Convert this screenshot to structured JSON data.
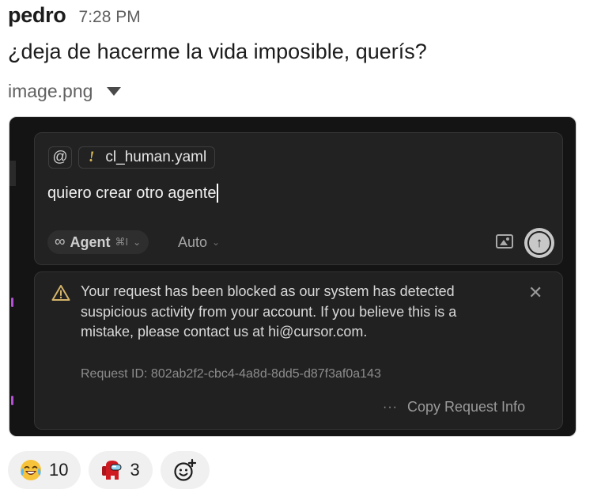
{
  "message": {
    "author": "pedro",
    "time": "7:28 PM",
    "text": "¿deja de hacerme la vida imposible, querís?"
  },
  "attachment": {
    "filename": "image.png",
    "toggle_icon": "caret-down-icon"
  },
  "screenshot": {
    "composer": {
      "mention_symbol": "@",
      "file_chip": {
        "marker": "!",
        "name": "cl_human.yaml"
      },
      "prompt": "quiero crear otro agente",
      "mode": {
        "icon": "infinity-icon",
        "label": "Agent",
        "shortcut": "⌘I",
        "chevron": "⌄"
      },
      "model": {
        "label": "Auto",
        "chevron": "⌄"
      },
      "image_icon": "image-icon",
      "send_icon": "arrow-up-icon"
    },
    "alert": {
      "icon": "warning-icon",
      "message": "Your request has been blocked as our system has detected suspicious activity from your account. If you believe this is a mistake, please contact us at hi@cursor.com.",
      "request_id": "Request ID: 802ab2f2-cbc4-4a8d-8dd5-d87f3af0a143",
      "close_symbol": "✕",
      "copy_dots": "···",
      "copy_label": "Copy Request Info"
    }
  },
  "reactions": [
    {
      "emoji": "joy-emoji",
      "count": "10"
    },
    {
      "emoji": "amongus-emoji",
      "count": "3"
    }
  ],
  "add_reaction_icon": "add-reaction-icon"
}
